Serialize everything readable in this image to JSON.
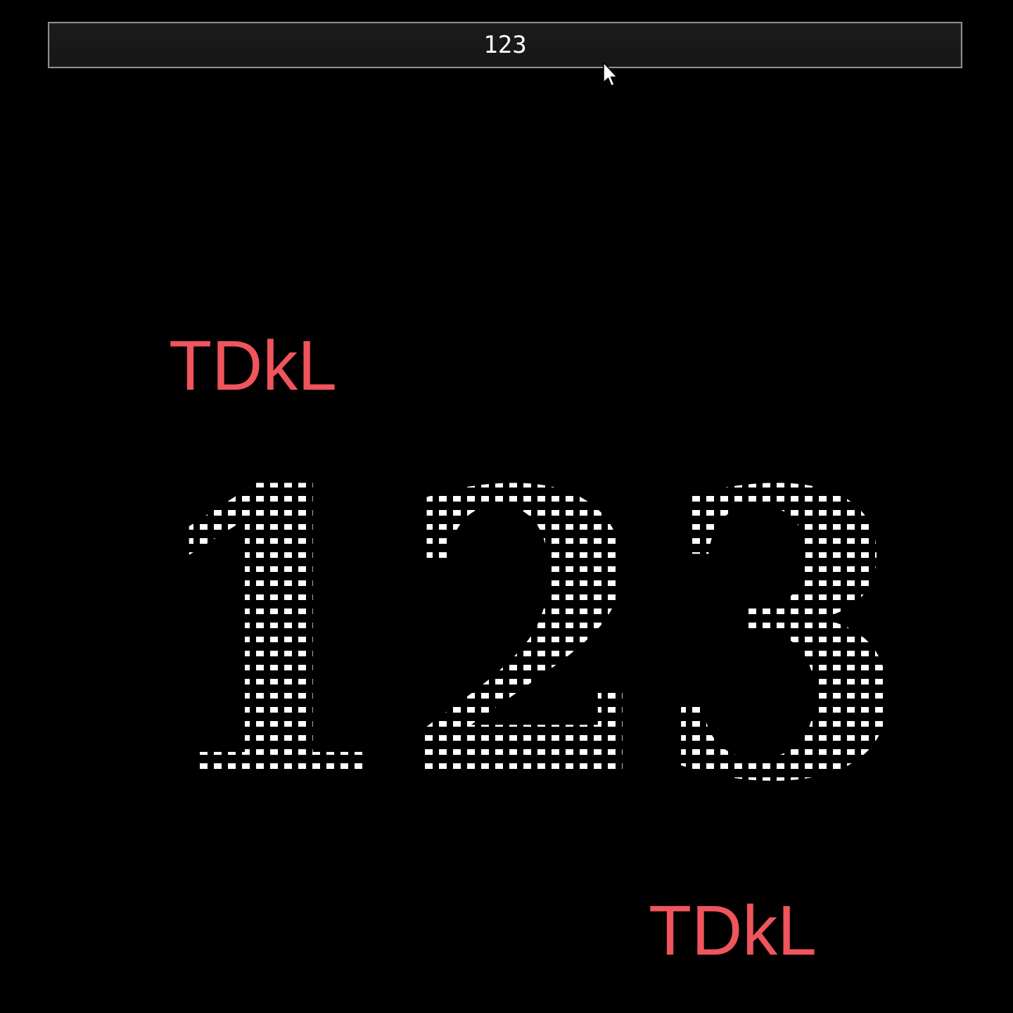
{
  "input": {
    "value": "123"
  },
  "labels": {
    "top": "TDkL",
    "bottom": "TDkL"
  },
  "display": {
    "digits": "123"
  },
  "colors": {
    "background": "#000000",
    "label": "#f0545c",
    "dots": "#ffffff",
    "input_bg": "#1a1a1a",
    "input_border": "#8d8d8d"
  },
  "icons": {
    "cursor": "mouse-pointer-arrow"
  }
}
